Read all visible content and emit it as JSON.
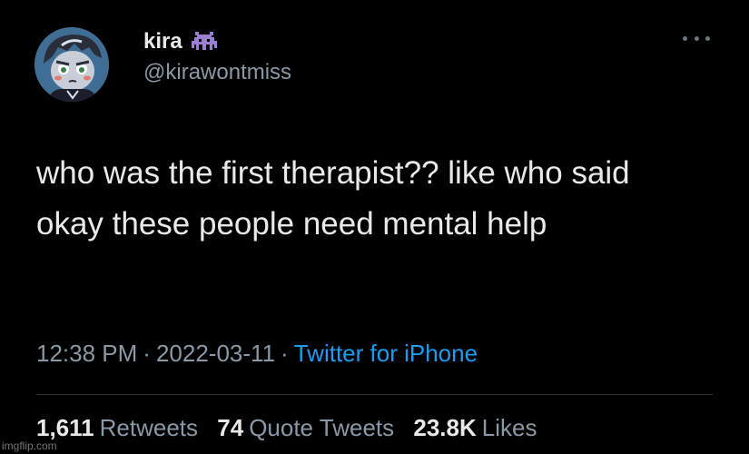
{
  "author": {
    "display_name": "kira",
    "handle": "@kirawontmiss",
    "avatar_icon": "cartoon-avatar",
    "name_emoji_icon": "alien-monster-icon"
  },
  "menu": {
    "icon": "more-icon"
  },
  "tweet": {
    "text": "who was the first therapist?? like who said okay these people need mental help"
  },
  "meta": {
    "time": "12:38 PM",
    "separator": "·",
    "date": "2022-03-11",
    "source": "Twitter for iPhone"
  },
  "stats": {
    "retweets_count": "1,611",
    "retweets_label": "Retweets",
    "quotes_count": "74",
    "quotes_label": "Quote Tweets",
    "likes_count": "23.8K",
    "likes_label": "Likes"
  },
  "watermark": "imgflip.com",
  "colors": {
    "background": "#000000",
    "text": "#e7e9ea",
    "secondary": "#8b98a5",
    "link": "#1d9bf0",
    "emoji": "#9b7fd0"
  }
}
